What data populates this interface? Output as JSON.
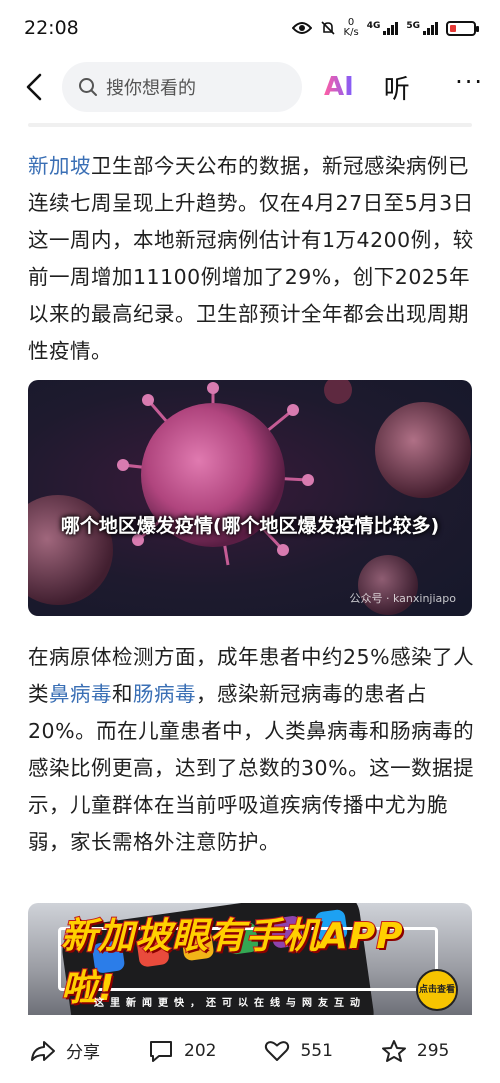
{
  "status_bar": {
    "time": "22:08",
    "net_speed_value": "0",
    "net_speed_unit": "K/s",
    "signal1_label": "4G",
    "signal2_label": "5G"
  },
  "nav": {
    "search_placeholder": "搜你想看的",
    "ai_label": "AI",
    "listen_label": "听",
    "more_label": "···"
  },
  "article": {
    "p1_link": "新加坡",
    "p1_text": "卫生部今天公布的数据，新冠感染病例已连续七周呈现上升趋势。仅在4月27日至5月3日这一周内，本地新冠病例估计有1万4200例，较前一周增加11100例增加了29%，创下2025年以来的最高纪录。卫生部预计全年都会出现周期性疫情。",
    "image1_caption": "哪个地区爆发疫情(哪个地区爆发疫情比较多)",
    "image1_watermark": "公众号 · kanxinjiapo",
    "p2_a": "在病原体检测方面，成年患者中约25%感染了人类",
    "p2_link1": "鼻病毒",
    "p2_b": "和",
    "p2_link2": "肠病毒",
    "p2_c": "，感染新冠病毒的患者占20%。而在儿童患者中，人类鼻病毒和肠病毒的感染比例更高，达到了总数的30%。这一数据提示，儿童群体在当前呼吸道疾病传播中尤为脆弱，家长需格外注意防护。",
    "image2_title": "新加坡眼有手机APP啦!",
    "image2_subtitle": "这里新闻更快，还可以在线与网友互动",
    "image2_badge": "点击查看"
  },
  "bottom_bar": {
    "share_label": "分享",
    "comment_count": "202",
    "like_count": "551",
    "favorite_count": "295"
  },
  "colors": {
    "link": "#3a6fb5",
    "ai_gradient_start": "#ff5fa2",
    "ai_gradient_end": "#7a5cff",
    "banner_yellow": "#ffd000"
  }
}
